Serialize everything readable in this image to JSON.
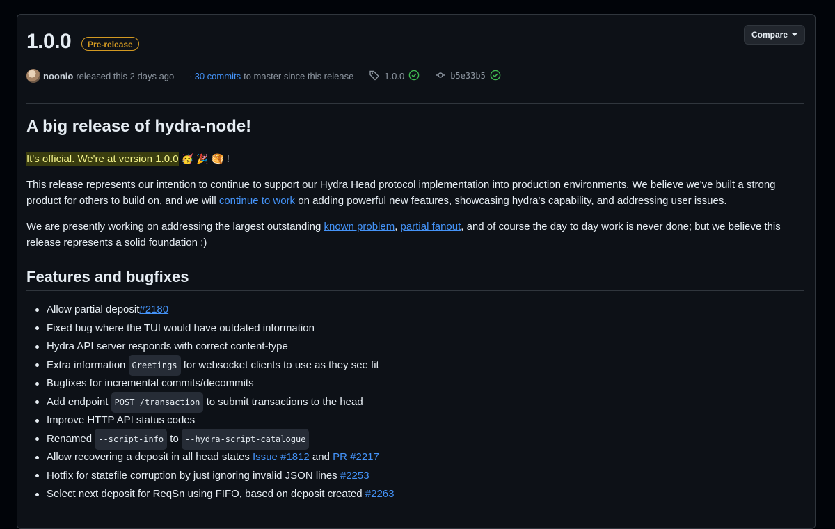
{
  "release": {
    "version": "1.0.0",
    "badge": "Pre-release",
    "compare_label": "Compare"
  },
  "meta": {
    "author": "noonio",
    "released": "released this 2 days ago",
    "dot": "·",
    "commits_link": "30 commits",
    "commits_suffix": "to master since this release",
    "tag": "1.0.0",
    "commit": "b5e33b5"
  },
  "body": {
    "heading": "A big release of hydra-node!",
    "official_text": "It's official. We're at version 1.0.0",
    "emojis": [
      "🥳",
      "🎉",
      "🥞"
    ],
    "exclaim": "!",
    "para1_a": "This release represents our intention to continue to support our Hydra Head protocol implementation into production environments. We believe we've built a strong product for others to build on, and we will ",
    "para1_link": "continue to work",
    "para1_b": " on adding powerful new features, showcasing hydra's capability, and addressing user issues.",
    "para2_a": "We are presently working on addressing the largest outstanding ",
    "para2_link1": "known problem",
    "para2_comma": ", ",
    "para2_link2": "partial fanout",
    "para2_b": ", and of course the day to day work is never done; but we believe this release represents a solid foundation :)"
  },
  "features": {
    "heading": "Features and bugfixes",
    "items": [
      {
        "text": "Allow partial deposit ",
        "link": "#2180"
      },
      {
        "text": "Fixed bug where the TUI would have outdated information"
      },
      {
        "text": "Hydra API server responds with correct content-type"
      },
      {
        "pre": "Extra information ",
        "code": "Greetings",
        "post": " for websocket clients to use as they see fit"
      },
      {
        "text": "Bugfixes for incremental commits/decommits"
      },
      {
        "pre": "Add endpoint ",
        "code": "POST /transaction",
        "post": " to submit transactions to the head"
      },
      {
        "text": "Improve HTTP API status codes"
      },
      {
        "pre": "Renamed ",
        "code": "--script-info",
        "mid": " to ",
        "code2": "--hydra-script-catalogue"
      },
      {
        "text": "Allow recovering a deposit in all head states ",
        "link": "Issue #1812",
        "and": " and ",
        "link2": "PR #2217"
      },
      {
        "text": "Hotfix for statefile corruption by just ignoring invalid JSON lines ",
        "link": "#2253"
      },
      {
        "text": "Select next deposit for ReqSn using FIFO, based on deposit created ",
        "link": "#2263"
      }
    ]
  },
  "colors": {
    "background": "#0d1117",
    "link": "#4493f8",
    "badge": "#d29922",
    "verified": "#3fb950"
  }
}
